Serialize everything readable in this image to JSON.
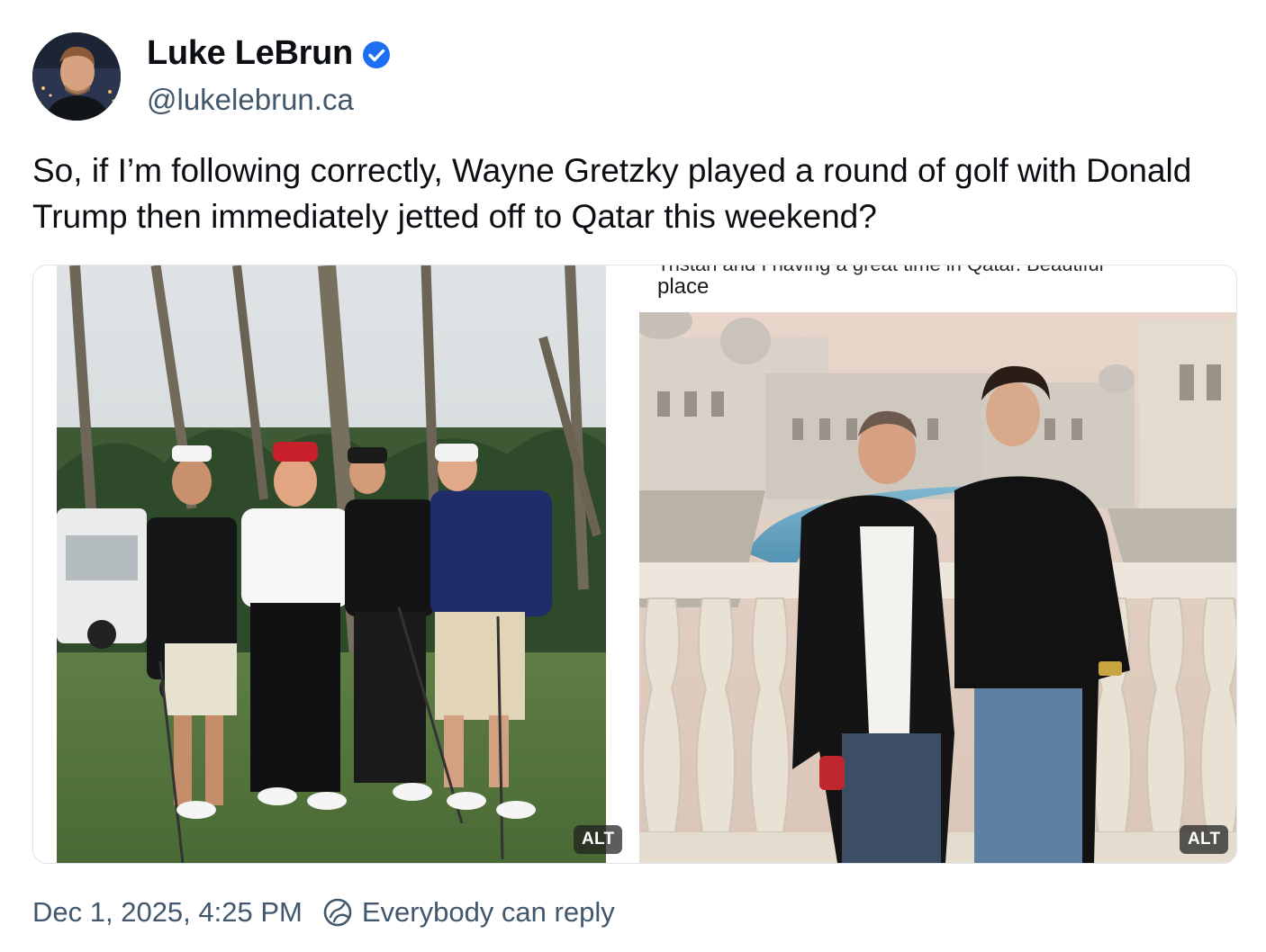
{
  "author": {
    "display_name": "Luke LeBrun",
    "handle": "@lukelebrun.ca",
    "verified": true,
    "avatar_icon": "avatar-photo",
    "verified_icon": "verified-check-icon",
    "verified_color": "#1d6ff2"
  },
  "post": {
    "text": "So, if I’m following correctly, Wayne Gretzky played a round of golf with Donald Trump then immediately jetted off to Qatar this weekend?"
  },
  "media": {
    "images": [
      {
        "subject": "golf-course-photo",
        "alt_badge": "ALT"
      },
      {
        "subject": "qatar-balcony-photo",
        "caption_cut": "Tristan and I having a great time in Qatar. Beautiful",
        "caption_line": "place",
        "alt_badge": "ALT"
      }
    ]
  },
  "footer": {
    "timestamp": "Dec 1, 2025, 4:25 PM",
    "reply_setting": "Everybody can reply",
    "reply_icon": "reply-globe-icon"
  },
  "colors": {
    "text_primary": "#0b0f14",
    "text_secondary": "#42576c",
    "border": "#dfe4ea"
  }
}
